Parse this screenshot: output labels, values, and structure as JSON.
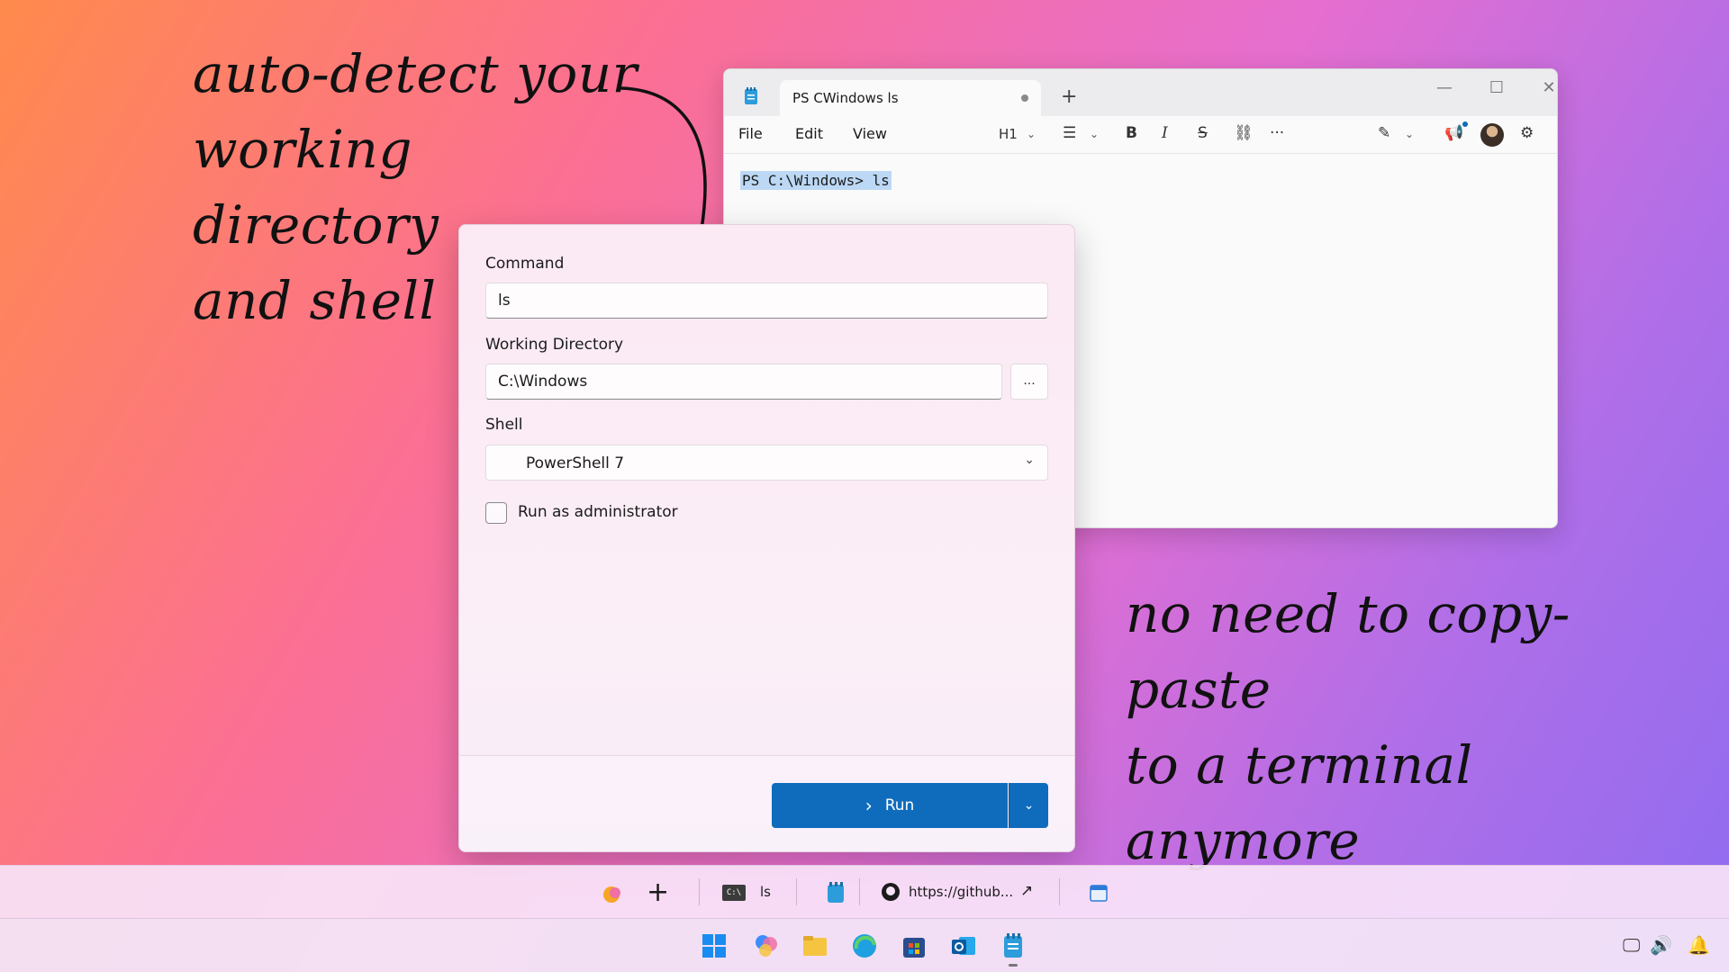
{
  "annotations": {
    "top_left": [
      "auto-detect your",
      "working directory",
      "and shell"
    ],
    "bottom_right": [
      "no need to copy-paste",
      "to a terminal anymore"
    ]
  },
  "notepad": {
    "tab_title": "PS CWindows ls",
    "menu": {
      "file": "File",
      "edit": "Edit",
      "view": "View"
    },
    "toolbar": {
      "heading": "H1",
      "bold": "B",
      "italic": "I",
      "strike": "S",
      "more": "···"
    },
    "content": "PS C:\\Windows> ls",
    "window_controls": {
      "minimize": "—",
      "maximize": "☐",
      "close": "✕"
    },
    "new_tab": "+"
  },
  "dialog": {
    "command_label": "Command",
    "command_value": "ls",
    "workdir_label": "Working Directory",
    "workdir_value": "C:\\Windows",
    "browse_label": "...",
    "shell_label": "Shell",
    "shell_value": "PowerShell 7",
    "admin_label": "Run as administrator",
    "admin_checked": false,
    "run_label": "Run"
  },
  "dock": {
    "add": "+",
    "terminal_label": "ls",
    "github_label": "https://github...",
    "cmd_icon_text": "C:\\"
  },
  "colors": {
    "accent": "#0f6cbd",
    "selection": "#bcd8f5"
  }
}
